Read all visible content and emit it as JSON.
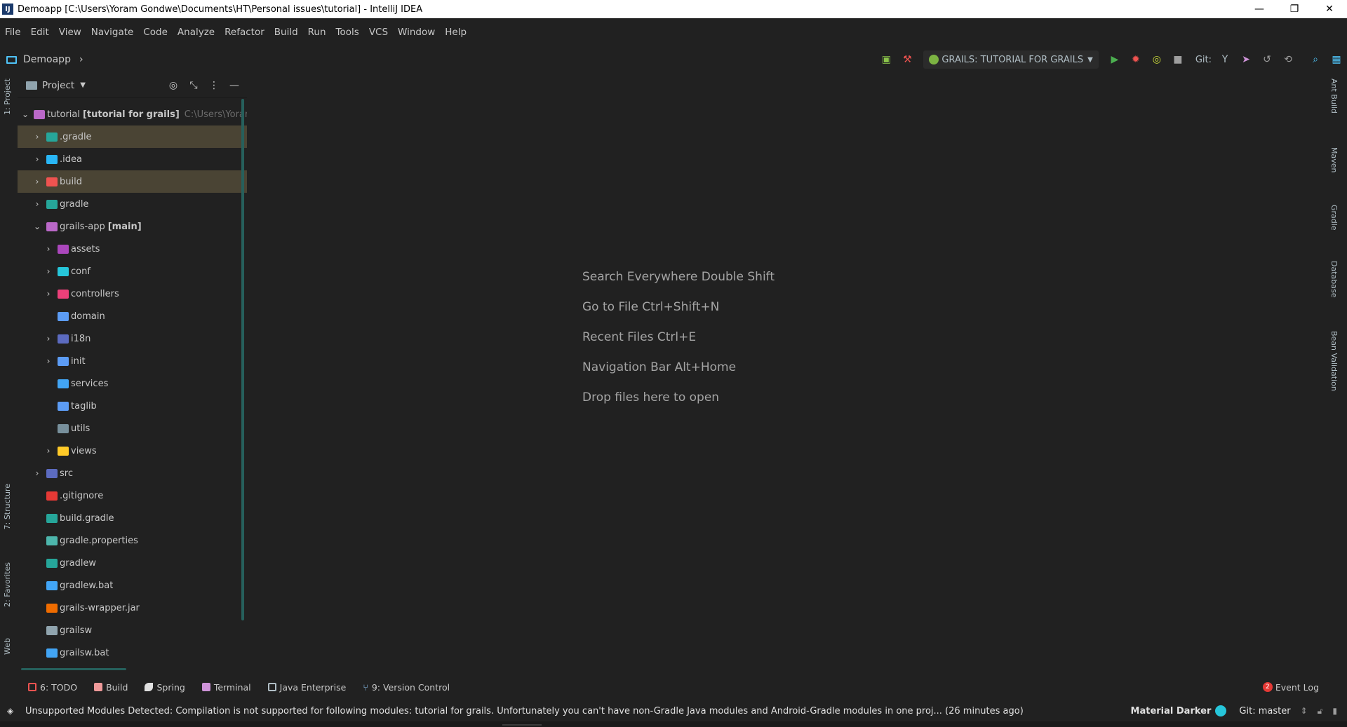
{
  "window": {
    "title": "Demoapp [C:\\Users\\Yoram Gondwe\\Documents\\HT\\Personal issues\\tutorial] - IntelliJ IDEA",
    "icon": "intellij-icon",
    "minimize": "—",
    "restore": "❐",
    "close": "✕"
  },
  "menu": [
    {
      "label": "File"
    },
    {
      "label": "Edit"
    },
    {
      "label": "View"
    },
    {
      "label": "Navigate"
    },
    {
      "label": "Code"
    },
    {
      "label": "Analyze"
    },
    {
      "label": "Refactor"
    },
    {
      "label": "Build"
    },
    {
      "label": "Run"
    },
    {
      "label": "Tools"
    },
    {
      "label": "VCS"
    },
    {
      "label": "Window"
    },
    {
      "label": "Help"
    }
  ],
  "nav": {
    "project": "Demoapp",
    "run_config": "GRAILS: TUTORIAL FOR GRAILS",
    "git_label": "Git:"
  },
  "left_tabs": [
    "1: Project",
    "7: Structure",
    "2: Favorites",
    "Web"
  ],
  "right_tabs": [
    "Ant Build",
    "Maven",
    "Gradle",
    "Database",
    "Bean Validation"
  ],
  "project_panel": {
    "title": "Project",
    "tree": [
      {
        "label": "tutorial",
        "bold": "[tutorial for grails]",
        "hint": "C:\\Users\\Yoram G",
        "depth": 0,
        "arrow": "down",
        "color": "#ba68c8",
        "hl": false
      },
      {
        "label": ".gradle",
        "bold": "",
        "hint": "",
        "depth": 1,
        "arrow": "right",
        "color": "#26a69a",
        "hl": true
      },
      {
        "label": ".idea",
        "bold": "",
        "hint": "",
        "depth": 1,
        "arrow": "right",
        "color": "#29b6f6",
        "hl": false
      },
      {
        "label": "build",
        "bold": "",
        "hint": "",
        "depth": 1,
        "arrow": "right",
        "color": "#ef5350",
        "hl": true
      },
      {
        "label": "gradle",
        "bold": "",
        "hint": "",
        "depth": 1,
        "arrow": "right",
        "color": "#26a69a",
        "hl": false
      },
      {
        "label": "grails-app",
        "bold": "[main]",
        "hint": "",
        "depth": 1,
        "arrow": "down",
        "color": "#ba68c8",
        "hl": false
      },
      {
        "label": "assets",
        "bold": "",
        "hint": "",
        "depth": 2,
        "arrow": "right",
        "color": "#ab47bc",
        "hl": false
      },
      {
        "label": "conf",
        "bold": "",
        "hint": "",
        "depth": 2,
        "arrow": "right",
        "color": "#26c6da",
        "hl": false
      },
      {
        "label": "controllers",
        "bold": "",
        "hint": "",
        "depth": 2,
        "arrow": "right",
        "color": "#ec407a",
        "hl": false
      },
      {
        "label": "domain",
        "bold": "",
        "hint": "",
        "depth": 2,
        "arrow": "",
        "color": "#5c9cf5",
        "hl": false
      },
      {
        "label": "i18n",
        "bold": "",
        "hint": "",
        "depth": 2,
        "arrow": "right",
        "color": "#5c6bc0",
        "hl": false
      },
      {
        "label": "init",
        "bold": "",
        "hint": "",
        "depth": 2,
        "arrow": "right",
        "color": "#5c9cf5",
        "hl": false
      },
      {
        "label": "services",
        "bold": "",
        "hint": "",
        "depth": 2,
        "arrow": "",
        "color": "#42a5f5",
        "hl": false
      },
      {
        "label": "taglib",
        "bold": "",
        "hint": "",
        "depth": 2,
        "arrow": "",
        "color": "#5c9cf5",
        "hl": false
      },
      {
        "label": "utils",
        "bold": "",
        "hint": "",
        "depth": 2,
        "arrow": "",
        "color": "#78909c",
        "hl": false
      },
      {
        "label": "views",
        "bold": "",
        "hint": "",
        "depth": 2,
        "arrow": "right",
        "color": "#ffca28",
        "hl": false
      },
      {
        "label": "src",
        "bold": "",
        "hint": "",
        "depth": 1,
        "arrow": "right",
        "color": "#5c6bc0",
        "hl": false
      },
      {
        "label": ".gitignore",
        "bold": "",
        "hint": "",
        "depth": 1,
        "arrow": "",
        "color": "#e53935",
        "hl": false
      },
      {
        "label": "build.gradle",
        "bold": "",
        "hint": "",
        "depth": 1,
        "arrow": "",
        "color": "#26a69a",
        "hl": false
      },
      {
        "label": "gradle.properties",
        "bold": "",
        "hint": "",
        "depth": 1,
        "arrow": "",
        "color": "#4db6ac",
        "hl": false
      },
      {
        "label": "gradlew",
        "bold": "",
        "hint": "",
        "depth": 1,
        "arrow": "",
        "color": "#26a69a",
        "hl": false
      },
      {
        "label": "gradlew.bat",
        "bold": "",
        "hint": "",
        "depth": 1,
        "arrow": "",
        "color": "#42a5f5",
        "hl": false
      },
      {
        "label": "grails-wrapper.jar",
        "bold": "",
        "hint": "",
        "depth": 1,
        "arrow": "",
        "color": "#ef6c00",
        "hl": false
      },
      {
        "label": "grailsw",
        "bold": "",
        "hint": "",
        "depth": 1,
        "arrow": "",
        "color": "#90a4ae",
        "hl": false
      },
      {
        "label": "grailsw.bat",
        "bold": "",
        "hint": "",
        "depth": 1,
        "arrow": "",
        "color": "#42a5f5",
        "hl": false
      }
    ]
  },
  "editor_hints": [
    "Search Everywhere  Double Shift",
    "Go to File  Ctrl+Shift+N",
    "Recent Files  Ctrl+E",
    "Navigation Bar  Alt+Home",
    "Drop files here to open"
  ],
  "bottom_tabs": [
    {
      "label": "6: TODO",
      "color": "#ef5350"
    },
    {
      "label": "Build",
      "color": "#ef9a9a"
    },
    {
      "label": "Spring",
      "color": "#e0e0e0"
    },
    {
      "label": "Terminal",
      "color": "#ce93d8"
    },
    {
      "label": "Java Enterprise",
      "color": "#b0bec5"
    },
    {
      "label": "9: Version Control",
      "color": "#90caf9"
    }
  ],
  "event_log": {
    "badge": "2",
    "label": "Event Log"
  },
  "status": {
    "message": "Unsupported Modules Detected: Compilation is not supported for following modules: tutorial for grails. Unfortunately you can't have non-Gradle Java modules and Android-Gradle modules in one proj... (26 minutes ago)",
    "theme": "Material Darker",
    "git_branch": "Git: master"
  }
}
